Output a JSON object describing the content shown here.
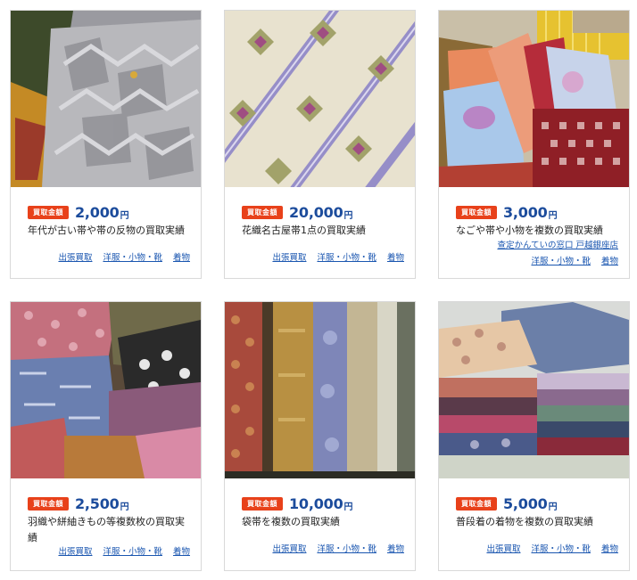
{
  "cards": [
    {
      "badge": "買取金額",
      "price": "2,000",
      "yen": "円",
      "title": "年代が古い帯や帯の反物の買取実績",
      "shop": "",
      "tags": [
        "出張買取",
        "洋服・小物・靴",
        "着物"
      ],
      "image": "old-obi-fabric-photo"
    },
    {
      "badge": "買取金額",
      "price": "20,000",
      "yen": "円",
      "title": "花織名古屋帯1点の買取実績",
      "shop": "",
      "tags": [
        "出張買取",
        "洋服・小物・靴",
        "着物"
      ],
      "image": "hanaori-nagoya-obi-photo"
    },
    {
      "badge": "買取金額",
      "price": "3,000",
      "yen": "円",
      "title": "なごや帯や小物を複数の買取実績",
      "shop": "查定かんていの窓口 戸越銀座店",
      "tags": [
        "洋服・小物・靴",
        "着物"
      ],
      "image": "nagoya-obi-accessories-photo"
    },
    {
      "badge": "買取金額",
      "price": "2,500",
      "yen": "円",
      "title": "羽織や絣紬きもの等複数枚の買取実績",
      "shop": "",
      "tags": [
        "出張買取",
        "洋服・小物・靴",
        "着物"
      ],
      "image": "haori-kasuri-kimono-photo"
    },
    {
      "badge": "買取金額",
      "price": "10,000",
      "yen": "円",
      "title": "袋帯を複数の買取実績",
      "shop": "",
      "tags": [
        "出張買取",
        "洋服・小物・靴",
        "着物"
      ],
      "image": "fukuro-obi-photo"
    },
    {
      "badge": "買取金額",
      "price": "5,000",
      "yen": "円",
      "title": "普段着の着物を複数の買取実績",
      "shop": "",
      "tags": [
        "出張買取",
        "洋服・小物・靴",
        "着物"
      ],
      "image": "everyday-kimono-photo"
    }
  ]
}
